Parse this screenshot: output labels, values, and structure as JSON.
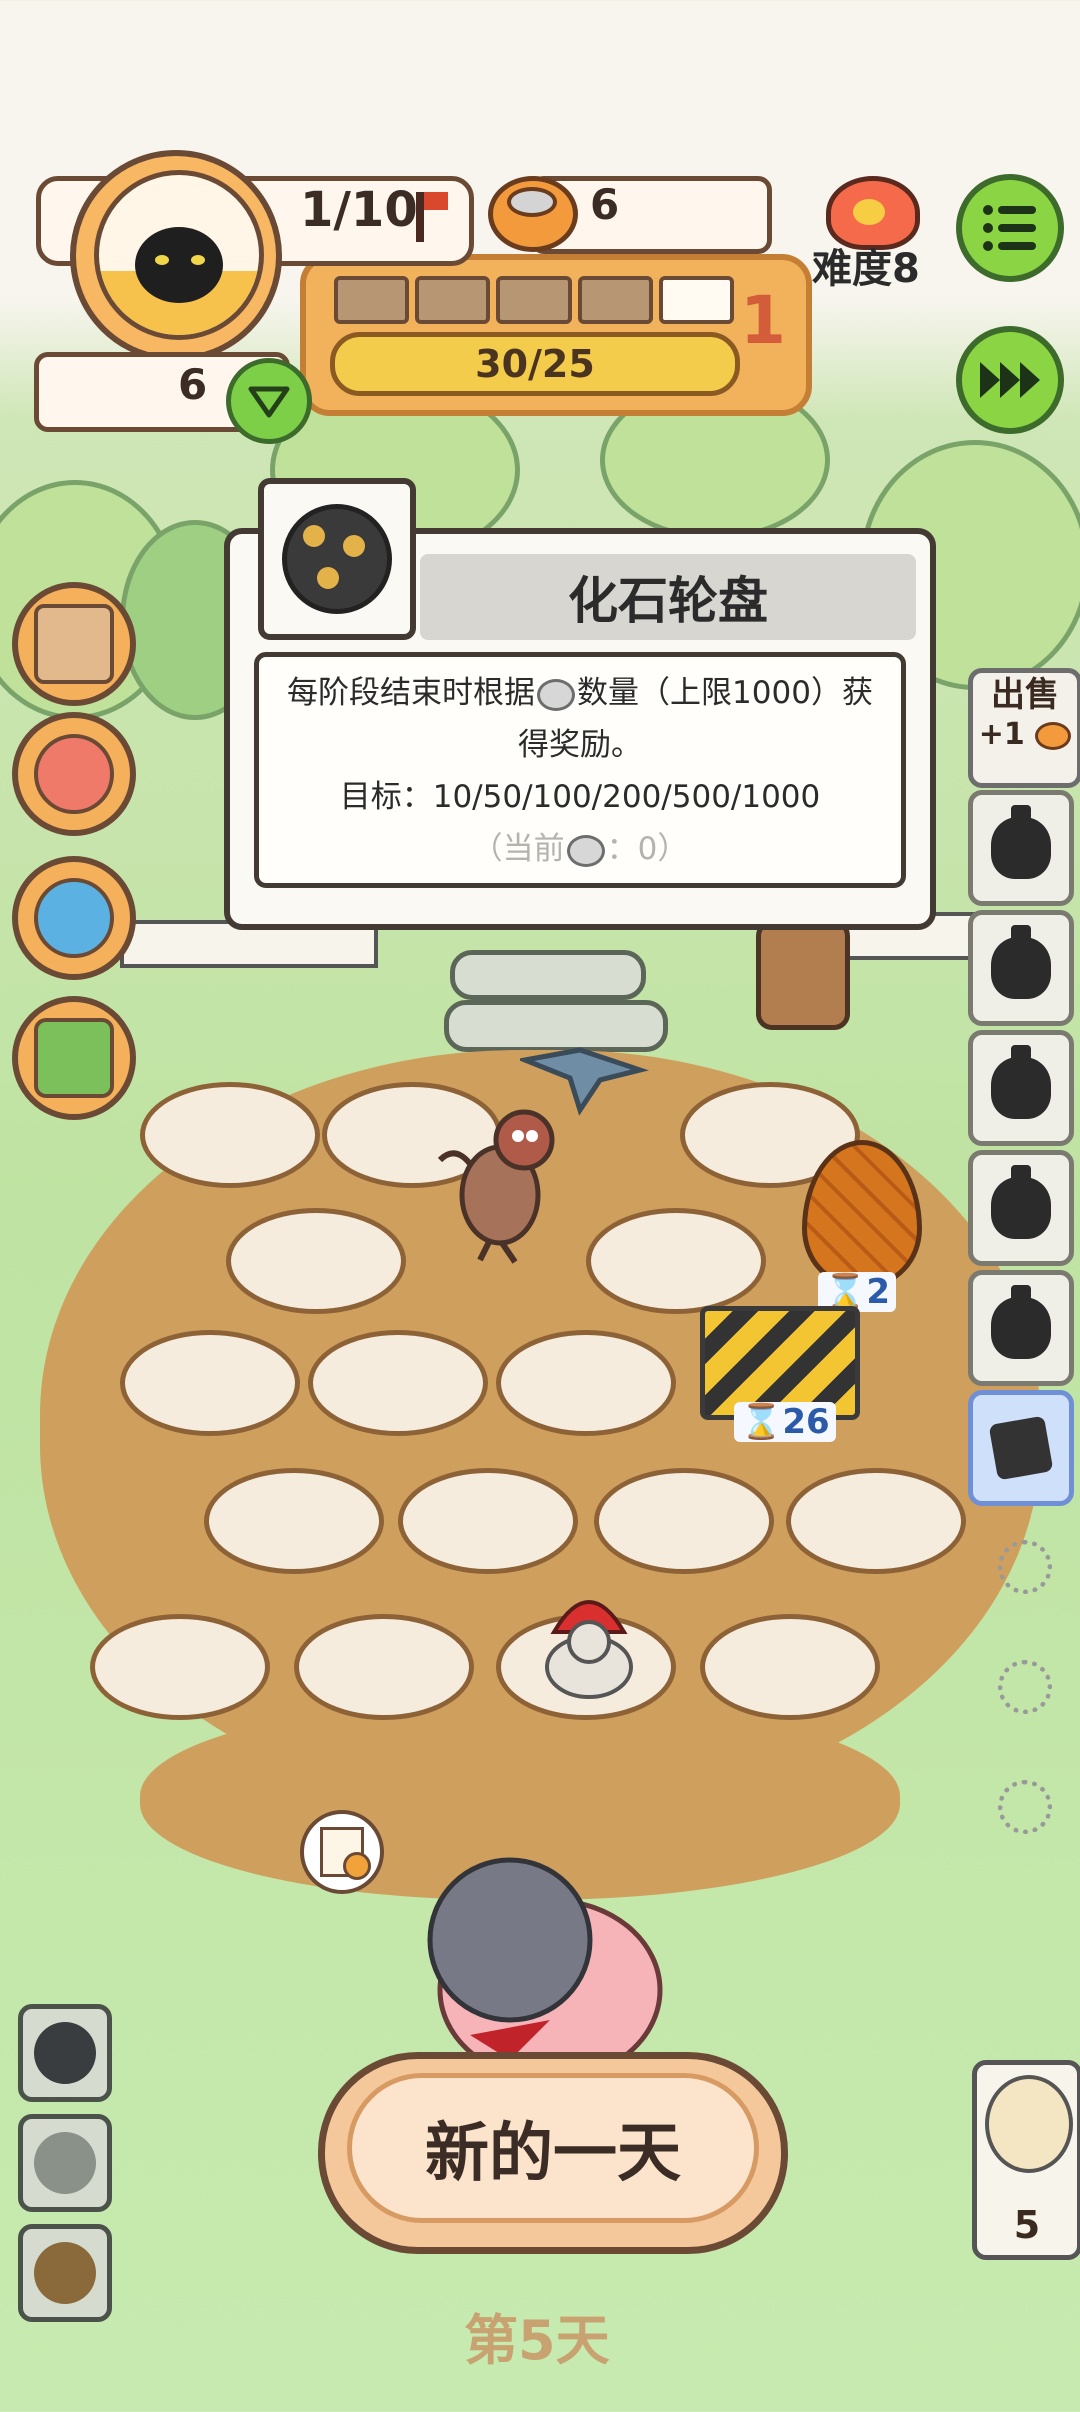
{
  "hud": {
    "progress_fraction": "1/10",
    "coins": "6",
    "difficulty": "难度8",
    "hearts": "6",
    "xp_bar_text": "30/25",
    "level_badge": "1",
    "segments_filled": 4,
    "segments_total": 5
  },
  "tooltip": {
    "title": "化石轮盘",
    "desc_part1": "每阶段结束时根据",
    "desc_part2": "数量（上限1000）获",
    "desc_line2": "得奖励。",
    "goal": "目标：10/50/100/200/500/1000",
    "current_prefix": "（当前",
    "current_suffix": "：0）"
  },
  "sell": {
    "label": "出售",
    "bonus": "+1"
  },
  "timers": {
    "egg": "2",
    "barrier": "26"
  },
  "new_day_button": "新的一天",
  "day_label": "第5天",
  "bird_count": "5",
  "colors": {
    "accent_orange": "#f2b25c",
    "green_button": "#8bd444",
    "dirt": "#cf9f5d"
  },
  "icons": [
    "menu-icon",
    "fast-forward-icon",
    "heart-down-icon",
    "flag-icon",
    "coin-bowl-icon",
    "flame-icon",
    "fossil-wheel-icon"
  ]
}
